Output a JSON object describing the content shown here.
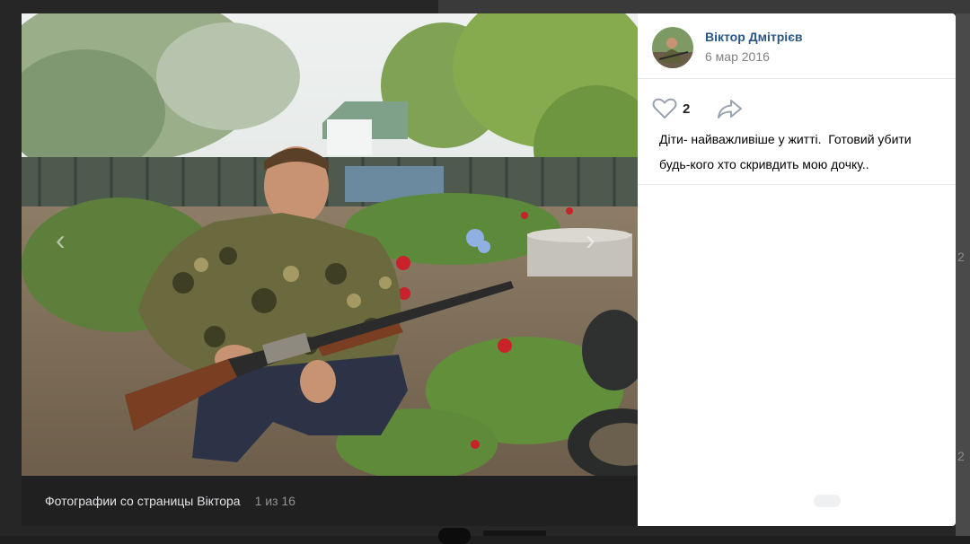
{
  "caption": {
    "title": "Фотографии со страницы Віктора",
    "counter": "1 из 16"
  },
  "author": {
    "name": "Віктор Дмітрієв",
    "date": "6 мар 2016"
  },
  "actions": {
    "like_icon": "heart-outline-icon",
    "like_count": "2",
    "share_icon": "share-arrow-icon"
  },
  "post": {
    "text": "Діти- найважливіше у житті.  Готовий убити будь-кого хто скривдить мою дочку.."
  },
  "background": {
    "right_numbers": [
      "2",
      "2"
    ]
  },
  "colors": {
    "link": "#2a5885",
    "muted": "#828282",
    "caption_bg": "#202020",
    "page_bg": "#262626"
  }
}
